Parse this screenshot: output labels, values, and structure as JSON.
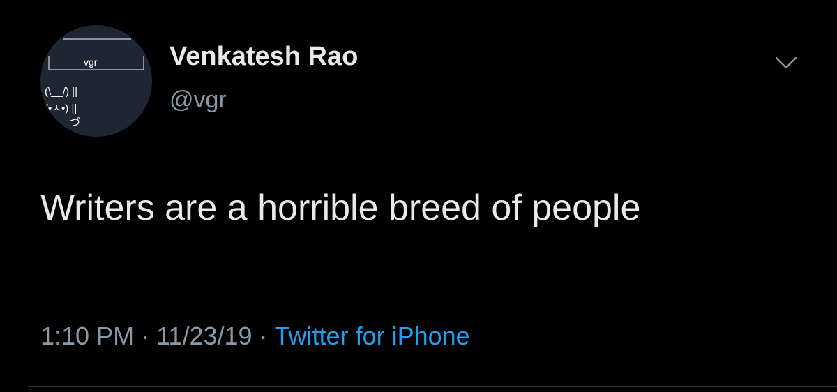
{
  "tweet": {
    "avatar": {
      "label": "vgr",
      "art_line1": "(\\__/) ||",
      "art_line2": "(•ㅅ•) ||",
      "art_line3": "づ",
      "background_color": "#1c2733"
    },
    "author": {
      "display_name": "Venkatesh Rao",
      "handle": "@vgr"
    },
    "menu": {
      "icon": "chevron-down-icon"
    },
    "text": "Writers are a horrible breed of people",
    "meta": {
      "time": "1:10 PM",
      "separator": "·",
      "date": "11/23/19",
      "source": "Twitter for iPhone"
    },
    "colors": {
      "background": "#000000",
      "primary_text": "#e7e9ea",
      "secondary_text": "#8899a6",
      "link": "#1da1f2",
      "divider": "#2f3336"
    }
  }
}
